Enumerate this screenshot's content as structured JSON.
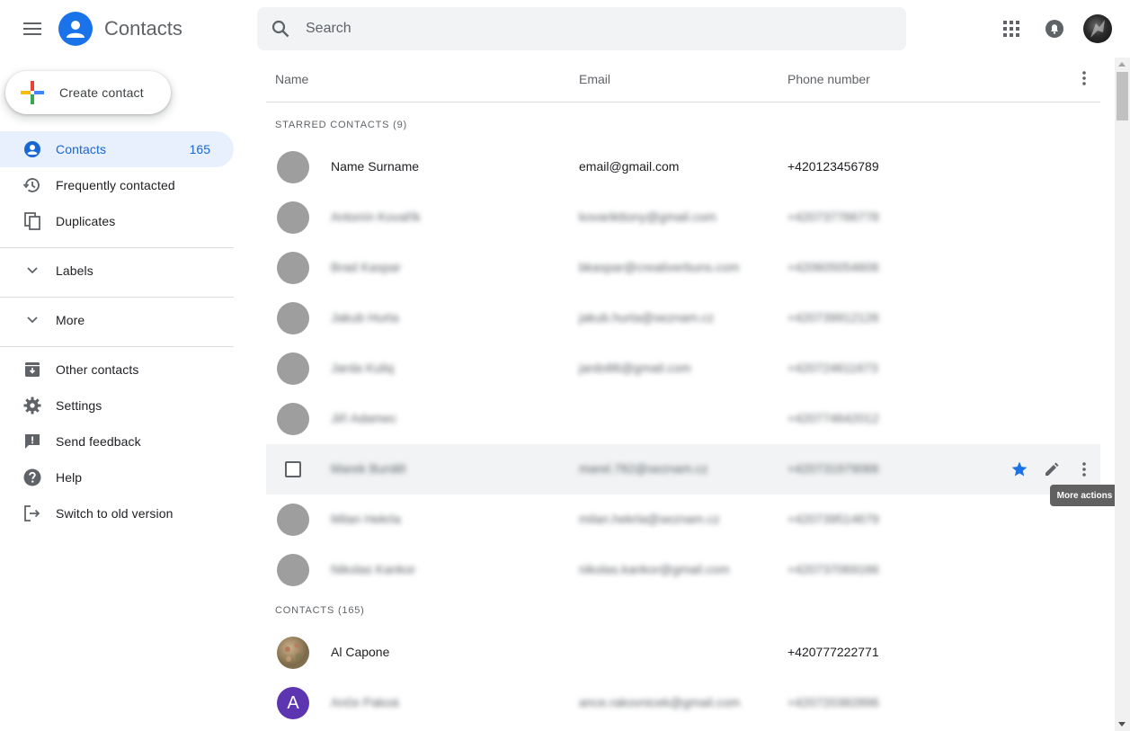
{
  "header": {
    "app_title": "Contacts",
    "search_placeholder": "Search"
  },
  "sidebar": {
    "create_label": "Create contact",
    "items": [
      {
        "label": "Contacts",
        "count": "165",
        "icon": "person-icon",
        "active": true
      },
      {
        "label": "Frequently contacted",
        "icon": "history-icon"
      },
      {
        "label": "Duplicates",
        "icon": "copy-icon"
      },
      {
        "label": "Labels",
        "icon": "chevron-down-icon"
      },
      {
        "label": "More",
        "icon": "chevron-down-icon"
      },
      {
        "label": "Other contacts",
        "icon": "archive-icon"
      },
      {
        "label": "Settings",
        "icon": "gear-icon"
      },
      {
        "label": "Send feedback",
        "icon": "feedback-icon"
      },
      {
        "label": "Help",
        "icon": "help-icon"
      },
      {
        "label": "Switch to old version",
        "icon": "exit-icon"
      }
    ]
  },
  "list": {
    "columns": [
      "Name",
      "Email",
      "Phone number"
    ],
    "starred_header": "STARRED CONTACTS (9)",
    "contacts_header": "CONTACTS (165)",
    "starred": [
      {
        "name": "Name Surname",
        "email": "email@gmail.com",
        "phone": "+420123456789",
        "blurred": false
      },
      {
        "name": "Antonín Kovařík",
        "email": "kovarikttony@gmail.com",
        "phone": "+420737766778",
        "blurred": true
      },
      {
        "name": "Brad Kaspar",
        "email": "bkaspar@creativerbuns.com",
        "phone": "+420605054606",
        "blurred": true
      },
      {
        "name": "Jakub Hurta",
        "email": "jakub.hurta@seznam.cz",
        "phone": "+420739912126",
        "blurred": true
      },
      {
        "name": "Jarda Kuliq",
        "email": "jardo86@gmail.com",
        "phone": "+420724611673",
        "blurred": true
      },
      {
        "name": "Jiří Adamec",
        "email": "",
        "phone": "+420774642012",
        "blurred": true
      },
      {
        "name": "Marek Burděl",
        "email": "marel.782@seznam.cz",
        "phone": "+420731979066",
        "blurred": true
      },
      {
        "name": "Milan Hekrla",
        "email": "milan.hekrla@seznam.cz",
        "phone": "+420739514679",
        "blurred": true
      },
      {
        "name": "Nikolas Kankor",
        "email": "nikolas.kankor@gmail.com",
        "phone": "+420737069166",
        "blurred": true
      }
    ],
    "contacts": [
      {
        "name": "Al Capone",
        "email": "",
        "phone": "+420777222771",
        "blurred": false
      },
      {
        "name": "Anče Pakoá",
        "email": "ance.rakovnicek@gmail.com",
        "phone": "+420720382896",
        "blurred": true,
        "initial": "A"
      }
    ],
    "tooltip": "More actions"
  },
  "colors": {
    "accent": "#1a73e8",
    "active_bg": "#e8f0fe",
    "star": "#1a73e8",
    "avatar_grey": "#9e9e9e",
    "avatar_purple": "#5e35b1"
  }
}
